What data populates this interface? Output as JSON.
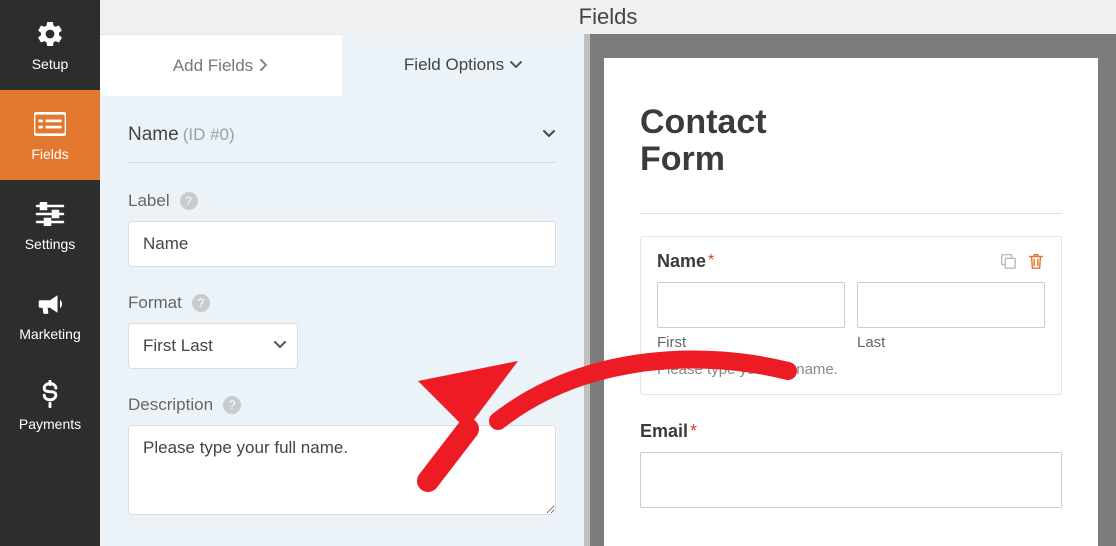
{
  "sidebar": {
    "items": [
      {
        "label": "Setup"
      },
      {
        "label": "Fields"
      },
      {
        "label": "Settings"
      },
      {
        "label": "Marketing"
      },
      {
        "label": "Payments"
      }
    ]
  },
  "topbar": {
    "title": "Fields"
  },
  "tabs": {
    "add": "Add Fields",
    "options": "Field Options"
  },
  "panel": {
    "heading_title": "Name",
    "heading_id": "(ID #0)",
    "label_label": "Label",
    "label_value": "Name",
    "format_label": "Format",
    "format_value": "First Last",
    "description_label": "Description",
    "description_value": "Please type your full name."
  },
  "preview": {
    "form_title_line1": "Contact",
    "form_title_line2": "Form",
    "name_field": {
      "label": "Name",
      "required": "*",
      "sub_first": "First",
      "sub_last": "Last",
      "description": "Please type your full name."
    },
    "email_field": {
      "label": "Email",
      "required": "*"
    }
  },
  "icons": {
    "gear": "gear",
    "fields": "fields",
    "sliders": "sliders",
    "bullhorn": "bullhorn",
    "dollar": "dollar"
  }
}
